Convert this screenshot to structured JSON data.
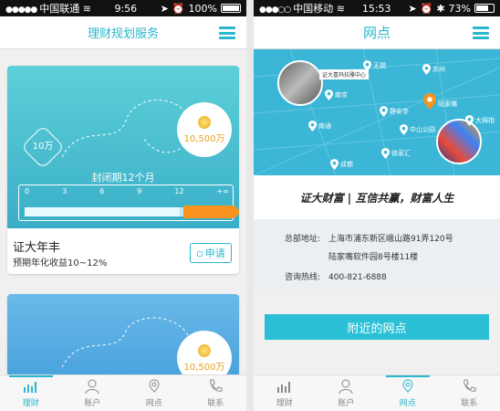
{
  "left": {
    "status": {
      "carrier": "中国联通",
      "time": "9:56",
      "battery": "100%",
      "battery_level": 1.0
    },
    "nav": {
      "title": "理财规划服务"
    },
    "card1": {
      "min_amount": "10万",
      "coin_amount": "10,500万",
      "period": "封闭期12个月",
      "ticks": [
        "0",
        "3",
        "6",
        "9",
        "12",
        "+∞"
      ],
      "product_name": "证大年丰",
      "rate": "预期年化收益10~12%",
      "apply": "申请"
    },
    "card2": {
      "coin_amount": "10,500万"
    },
    "tabs": [
      "理财",
      "账户",
      "网点",
      "联系"
    ],
    "active_tab": "理财"
  },
  "right": {
    "status": {
      "carrier": "中国移动",
      "time": "15:53",
      "battery": "73%",
      "battery_level": 0.73
    },
    "nav": {
      "title": "网点"
    },
    "map": {
      "photo_tag": "证大喜玛拉雅中心",
      "places": [
        "无锡",
        "苏州",
        "南京",
        "静安寺",
        "陆家嘴",
        "南通",
        "中山公园",
        "大拇指",
        "成都",
        "徐家汇"
      ]
    },
    "slogan": "证大财富 | 互信共赢，财富人生",
    "info": {
      "address_label": "总部地址:",
      "address_line1": "上海市浦东新区峨山路91弄120号",
      "address_line2": "陆家嘴软件园8号楼11楼",
      "hotline_label": "咨询热线:",
      "hotline": "400-821-6888"
    },
    "nearby_button": "附近的网点",
    "tabs": [
      "理财",
      "账户",
      "网点",
      "联系"
    ],
    "active_tab": "网点"
  },
  "colors": {
    "accent": "#29b6cf",
    "orange": "#f7931e",
    "map": "#3bb6d6"
  }
}
